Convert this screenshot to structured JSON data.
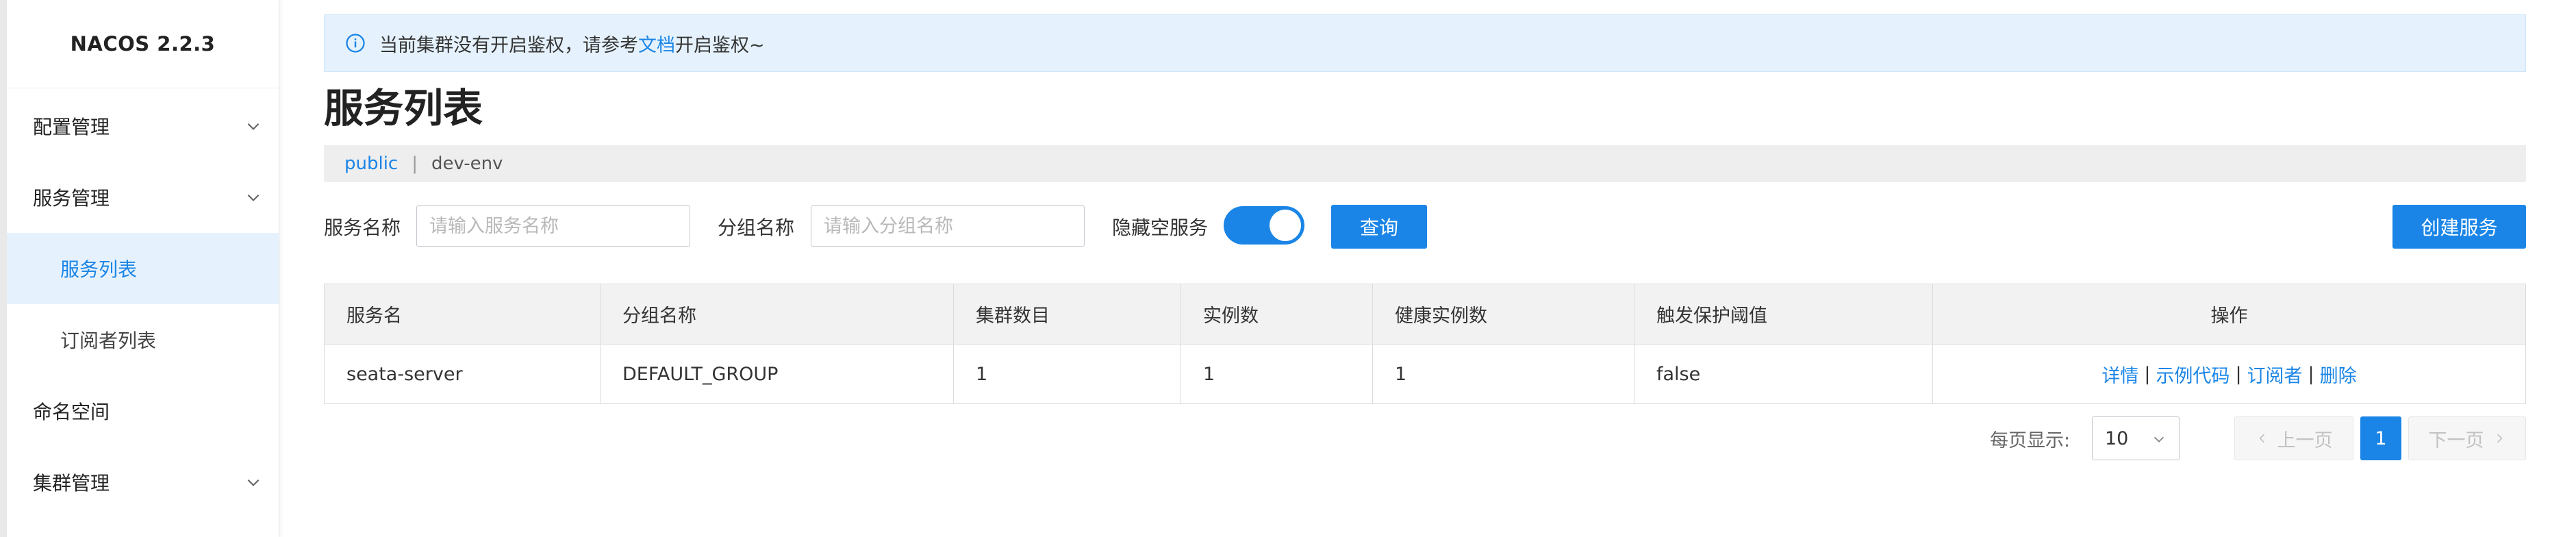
{
  "app": {
    "brand": "NACOS 2.2.3"
  },
  "sidebar": {
    "items": [
      {
        "label": "配置管理",
        "expandable": true
      },
      {
        "label": "服务管理",
        "expandable": true
      },
      {
        "label": "服务列表",
        "active": true
      },
      {
        "label": "订阅者列表"
      },
      {
        "label": "命名空间"
      },
      {
        "label": "集群管理",
        "expandable": true
      }
    ]
  },
  "notice": {
    "text_before": "当前集群没有开启鉴权，请参考",
    "link": "文档",
    "text_after": "开启鉴权~"
  },
  "page": {
    "title": "服务列表"
  },
  "namespaces": {
    "active": "public",
    "separator": "|",
    "other": "dev-env"
  },
  "filters": {
    "service_name_label": "服务名称",
    "service_name_placeholder": "请输入服务名称",
    "group_name_label": "分组名称",
    "group_name_placeholder": "请输入分组名称",
    "hide_empty_label": "隐藏空服务",
    "hide_empty_on": true,
    "query_button": "查询",
    "create_button": "创建服务"
  },
  "table": {
    "headers": [
      "服务名",
      "分组名称",
      "集群数目",
      "实例数",
      "健康实例数",
      "触发保护阈值",
      "操作"
    ],
    "rows": [
      {
        "service": "seata-server",
        "group": "DEFAULT_GROUP",
        "clusters": "1",
        "instances": "1",
        "healthy": "1",
        "threshold": "false",
        "ops": [
          "详情",
          "示例代码",
          "订阅者",
          "删除"
        ],
        "op_sep": "|"
      }
    ]
  },
  "pagination": {
    "page_size_label": "每页显示:",
    "page_size": "10",
    "prev": "上一页",
    "current_page": "1",
    "next": "下一页"
  },
  "colors": {
    "accent": "#1a85e6",
    "notice_bg": "#e5f2fd",
    "active_nav_bg": "#e5f2fd"
  }
}
